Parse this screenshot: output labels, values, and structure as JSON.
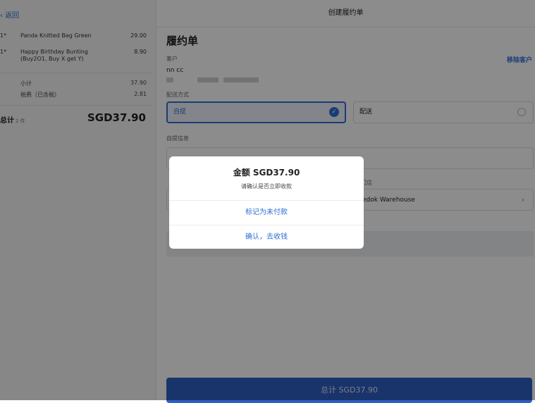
{
  "left": {
    "back_label": "返回",
    "items": [
      {
        "qty": "1*",
        "name": "Panda Knitted Bag Green",
        "price": "29.00"
      },
      {
        "qty": "1*",
        "name": "Happy Birthday Bunting (Buy2O1, Buy X get Y)",
        "price": "8.90"
      }
    ],
    "subtotal_label": "小计",
    "subtotal_value": "37.90",
    "tax_label": "税费（已含税）",
    "tax_value": "2.81",
    "total_label": "总计",
    "total_count": "2 件",
    "total_amount": "SGD37.90"
  },
  "right": {
    "page_title": "创建履约单",
    "heading": "履约单",
    "customer_label": "客户",
    "remove_customer": "移除客户",
    "customer_name": "nn cc",
    "delivery_label": "配送方式",
    "option_pickup": "自提",
    "option_delivery": "配送",
    "pickup_info_label": "自提信息",
    "store_label": "门店",
    "store_value": "edok Warehouse",
    "bottom_button": "总计 SGD37.90"
  },
  "dialog": {
    "title": "金额 SGD37.90",
    "subtitle": "请确认是否立即收款",
    "mark_unpaid": "标记为未付款",
    "confirm": "确认，去收钱"
  },
  "colors": {
    "accent": "#2f6fd6",
    "primary_button": "#2f5fc4",
    "overlay": "rgba(0,0,0,0.45)"
  }
}
